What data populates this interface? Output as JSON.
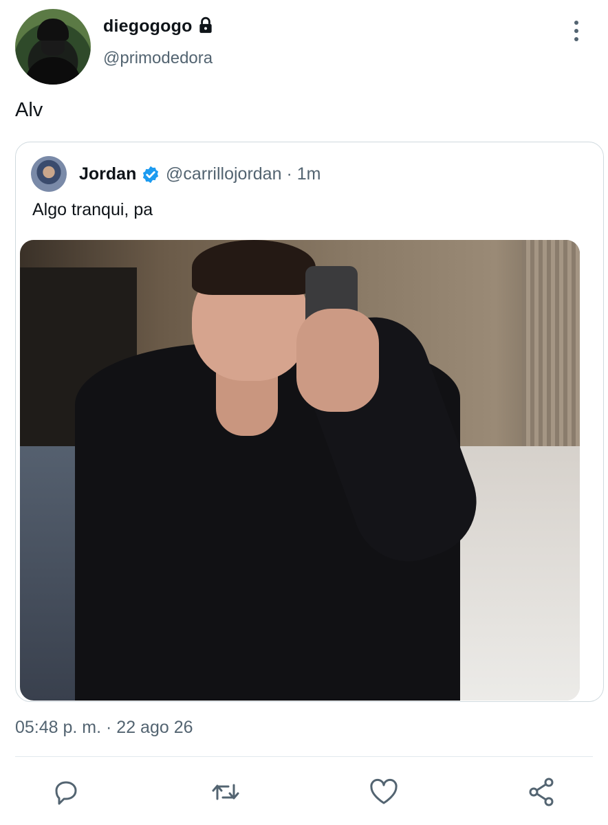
{
  "tweet": {
    "author_name": "diegogogo",
    "author_handle": "@primodedora",
    "text": "Alv",
    "timestamp": "05:48 p. m. · 22 ago 26"
  },
  "quoted_tweet": {
    "author_name": "Jordan",
    "author_handle": "@carrillojordan · 1m",
    "text": "Algo tranqui, pa"
  },
  "icons": {
    "lock": "lock-icon",
    "verified": "verified-badge-icon",
    "more": "more-vertical-icon",
    "reply": "reply-icon",
    "retweet": "retweet-icon",
    "like": "heart-icon",
    "share": "share-icon"
  },
  "colors": {
    "secondary_text": "#536471",
    "verified_blue": "#1d9bf0",
    "border": "#cfd9de"
  }
}
